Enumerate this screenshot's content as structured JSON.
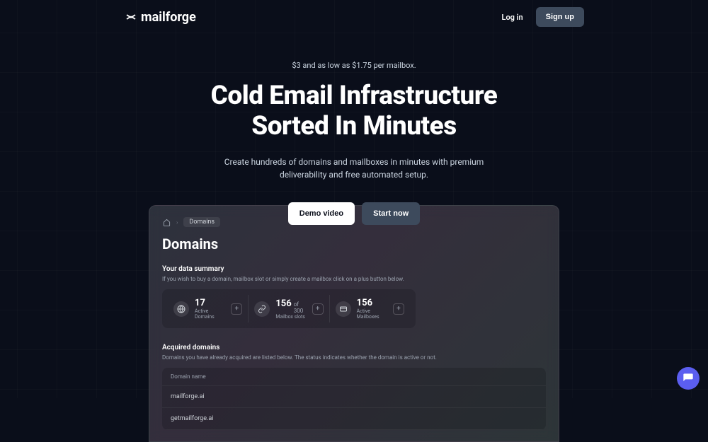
{
  "header": {
    "logo_text": "mailforge",
    "login_label": "Log in",
    "signup_label": "Sign up"
  },
  "hero": {
    "tagline": "$3 and as low as $1.75 per mailbox.",
    "title_line1": "Cold Email Infrastructure",
    "title_line2": "Sorted In Minutes",
    "description": "Create hundreds of domains and mailboxes in minutes with premium deliverability and free automated setup.",
    "demo_button": "Demo video",
    "start_button": "Start now"
  },
  "screenshot": {
    "breadcrumb_current": "Domains",
    "page_title": "Domains",
    "summary_label": "Your data summary",
    "summary_sub": "If you wish to buy a domain, mailbox slot or simply create a mailbox click on a plus button below.",
    "stats": [
      {
        "number": "17",
        "of": "",
        "label": "Active Domains"
      },
      {
        "number": "156",
        "of": "of 300",
        "label": "Mailbox slots"
      },
      {
        "number": "156",
        "of": "",
        "label": "Active Mailboxes"
      }
    ],
    "acquired_label": "Acquired domains",
    "acquired_sub": "Domains you have already acquired are listed below. The status indicates whether the domain is active or not.",
    "table_header": "Domain name",
    "domains": [
      "mailforge.ai",
      "getmailforge.ai"
    ]
  }
}
